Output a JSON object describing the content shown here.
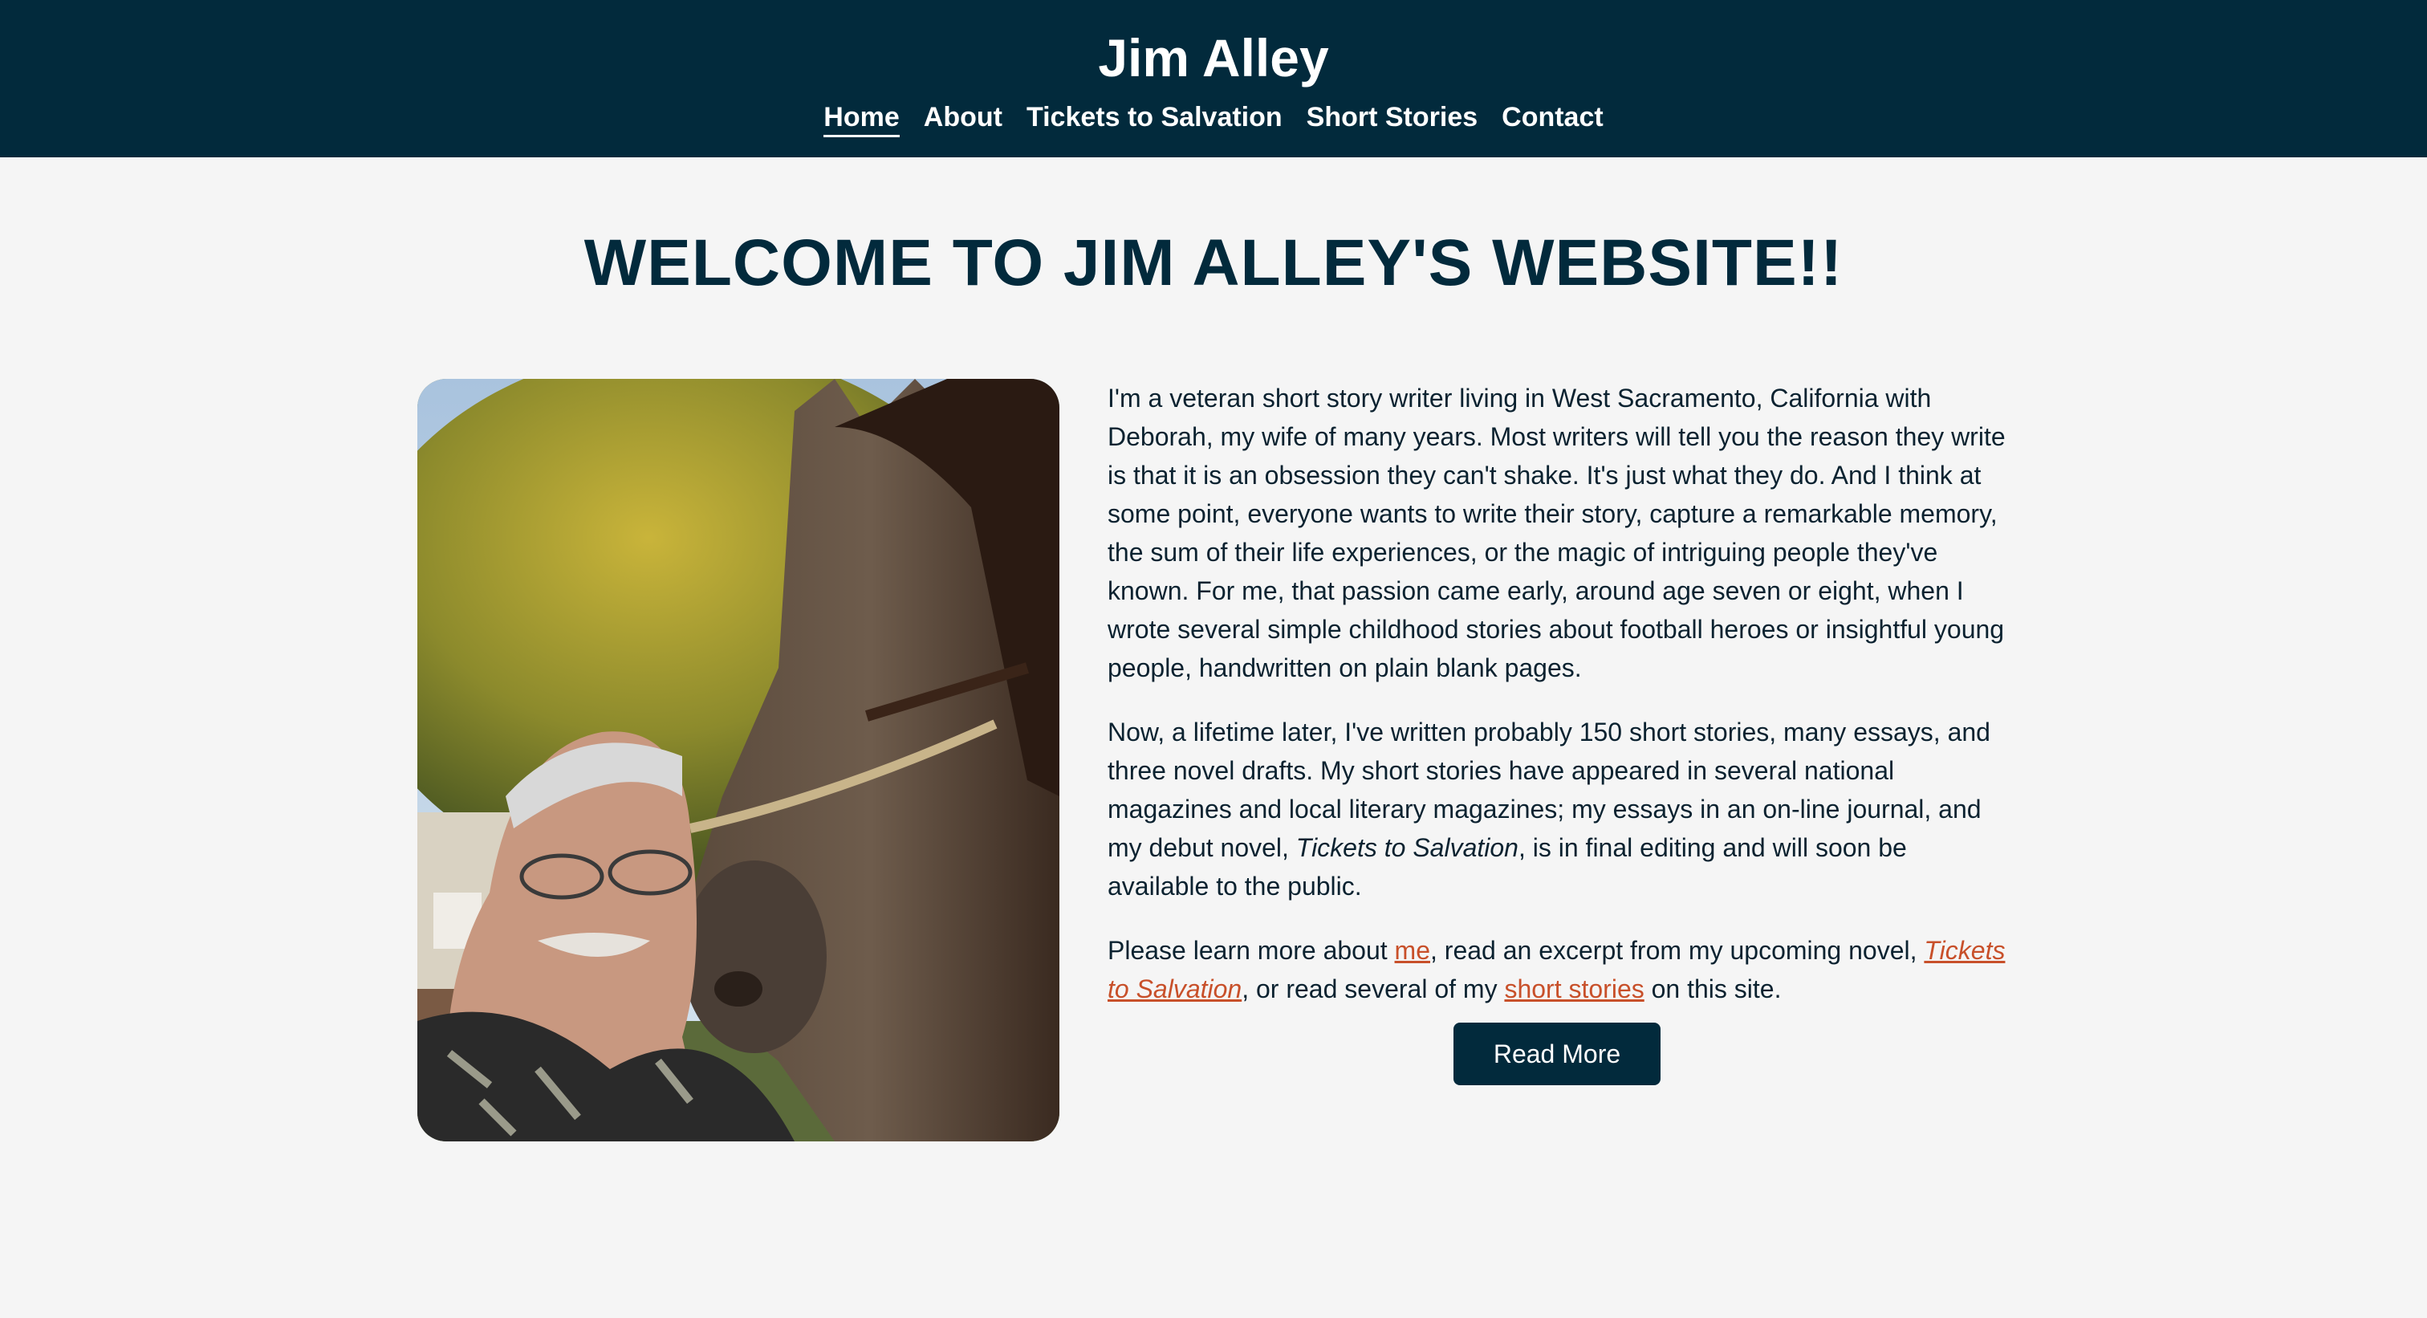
{
  "header": {
    "site_title": "Jim Alley",
    "nav": [
      "Home",
      "About",
      "Tickets to Salvation",
      "Short Stories",
      "Contact"
    ]
  },
  "main": {
    "heading": "WELCOME TO JIM ALLEY'S WEBSITE!!",
    "paragraph1": "I'm a veteran short story writer living in West Sacramento, California with Deborah, my wife of many years. Most writers will tell you the reason they write is that it is an obsession they can't shake. It's just what they do. And I think at some point, everyone wants to write their story, capture a remarkable memory, the sum of their life experiences, or the magic of intriguing people they've known. For me, that passion came early, around age seven or eight, when I wrote several simple childhood stories about football heroes or insightful young people, handwritten on plain blank pages.",
    "paragraph2": {
      "before": "Now, a lifetime later, I've written probably 150 short stories, many essays, and three novel drafts. My short stories have appeared in several national magazines and local literary magazines; my essays in an on-line journal, and my debut novel, ",
      "novel": "Tickets to Salvation",
      "after": ", is in final editing and will soon be available to the public."
    },
    "paragraph3": {
      "t1": "Please learn more about ",
      "link_me": "me",
      "t2": ", read an excerpt from my upcoming novel, ",
      "link_novel": "Tickets to Salvation",
      "t3": ", or read several of my ",
      "link_stories": "short stories",
      "t4": " on this site."
    },
    "read_more": "Read More"
  },
  "colors": {
    "header_bg": "#022a3c",
    "page_bg": "#f5f5f5",
    "link": "#c8502a"
  }
}
